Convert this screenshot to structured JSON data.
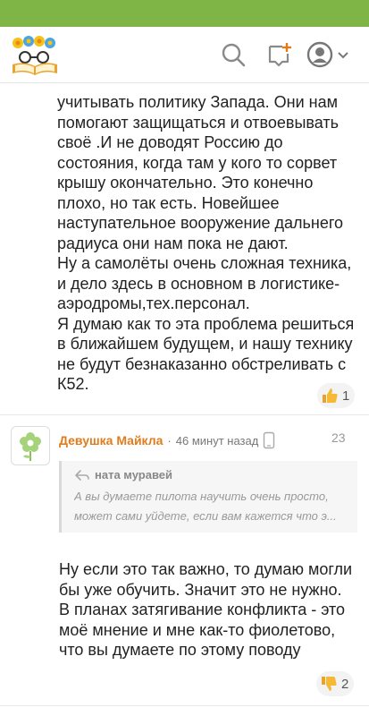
{
  "header": {
    "logo_icon": "flower-book-logo-icon",
    "search_icon": "search-icon",
    "add_post_icon": "add-post-icon",
    "profile_icon": "profile-icon",
    "dropdown_icon": "chevron-down-icon",
    "brand_color": "#7fb446"
  },
  "comment1": {
    "paragraphs": [
      "учитывать политику Запада. Они нам помогают защищаться и отвоевывать своё .И не доводят Россию до состояния, когда там у кого то сорвет крышу окончательно. Это конечно плохо, но так есть. Новейшее наступательное вооружение дальнего радиуса они нам пока не дают.",
      "Ну а самолёты очень сложная техника, и дело здесь в основном в логистике-аэродромы,тех.персонал.",
      "Я думаю как то эта проблема решиться в ближайшем будущем, и нашу технику не будут безнаказанно обстреливать с К52."
    ],
    "likes": "1"
  },
  "comment2": {
    "author": "Девушка Майкла",
    "separator": "·",
    "time": "46 минут назад",
    "number": "23",
    "author_color": "#e07c1c",
    "quote": {
      "author": "ната муравей",
      "text": "А вы думаете пилота научить очень просто, может сами уйдете, если вам кажется что э..."
    },
    "text": "Ну если это так важно, то думаю могли бы уже обучить. Значит это не нужно. В планах затягивание конфликта - это моё мнение и мне как-то фиолетово, что вы думаете по этому поводу",
    "dislikes": "2"
  }
}
